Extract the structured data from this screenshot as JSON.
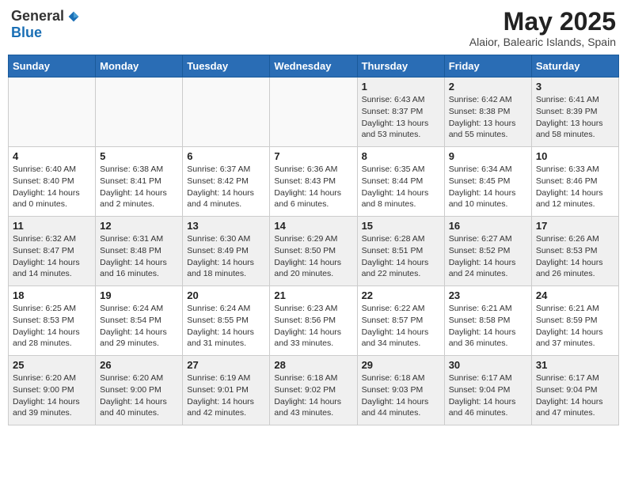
{
  "header": {
    "logo_general": "General",
    "logo_blue": "Blue",
    "month_year": "May 2025",
    "location": "Alaior, Balearic Islands, Spain"
  },
  "weekdays": [
    "Sunday",
    "Monday",
    "Tuesday",
    "Wednesday",
    "Thursday",
    "Friday",
    "Saturday"
  ],
  "rows": [
    [
      {
        "day": "",
        "empty": true
      },
      {
        "day": "",
        "empty": true
      },
      {
        "day": "",
        "empty": true
      },
      {
        "day": "",
        "empty": true
      },
      {
        "day": "1",
        "lines": [
          "Sunrise: 6:43 AM",
          "Sunset: 8:37 PM",
          "Daylight: 13 hours",
          "and 53 minutes."
        ]
      },
      {
        "day": "2",
        "lines": [
          "Sunrise: 6:42 AM",
          "Sunset: 8:38 PM",
          "Daylight: 13 hours",
          "and 55 minutes."
        ]
      },
      {
        "day": "3",
        "lines": [
          "Sunrise: 6:41 AM",
          "Sunset: 8:39 PM",
          "Daylight: 13 hours",
          "and 58 minutes."
        ]
      }
    ],
    [
      {
        "day": "4",
        "lines": [
          "Sunrise: 6:40 AM",
          "Sunset: 8:40 PM",
          "Daylight: 14 hours",
          "and 0 minutes."
        ]
      },
      {
        "day": "5",
        "lines": [
          "Sunrise: 6:38 AM",
          "Sunset: 8:41 PM",
          "Daylight: 14 hours",
          "and 2 minutes."
        ]
      },
      {
        "day": "6",
        "lines": [
          "Sunrise: 6:37 AM",
          "Sunset: 8:42 PM",
          "Daylight: 14 hours",
          "and 4 minutes."
        ]
      },
      {
        "day": "7",
        "lines": [
          "Sunrise: 6:36 AM",
          "Sunset: 8:43 PM",
          "Daylight: 14 hours",
          "and 6 minutes."
        ]
      },
      {
        "day": "8",
        "lines": [
          "Sunrise: 6:35 AM",
          "Sunset: 8:44 PM",
          "Daylight: 14 hours",
          "and 8 minutes."
        ]
      },
      {
        "day": "9",
        "lines": [
          "Sunrise: 6:34 AM",
          "Sunset: 8:45 PM",
          "Daylight: 14 hours",
          "and 10 minutes."
        ]
      },
      {
        "day": "10",
        "lines": [
          "Sunrise: 6:33 AM",
          "Sunset: 8:46 PM",
          "Daylight: 14 hours",
          "and 12 minutes."
        ]
      }
    ],
    [
      {
        "day": "11",
        "lines": [
          "Sunrise: 6:32 AM",
          "Sunset: 8:47 PM",
          "Daylight: 14 hours",
          "and 14 minutes."
        ]
      },
      {
        "day": "12",
        "lines": [
          "Sunrise: 6:31 AM",
          "Sunset: 8:48 PM",
          "Daylight: 14 hours",
          "and 16 minutes."
        ]
      },
      {
        "day": "13",
        "lines": [
          "Sunrise: 6:30 AM",
          "Sunset: 8:49 PM",
          "Daylight: 14 hours",
          "and 18 minutes."
        ]
      },
      {
        "day": "14",
        "lines": [
          "Sunrise: 6:29 AM",
          "Sunset: 8:50 PM",
          "Daylight: 14 hours",
          "and 20 minutes."
        ]
      },
      {
        "day": "15",
        "lines": [
          "Sunrise: 6:28 AM",
          "Sunset: 8:51 PM",
          "Daylight: 14 hours",
          "and 22 minutes."
        ]
      },
      {
        "day": "16",
        "lines": [
          "Sunrise: 6:27 AM",
          "Sunset: 8:52 PM",
          "Daylight: 14 hours",
          "and 24 minutes."
        ]
      },
      {
        "day": "17",
        "lines": [
          "Sunrise: 6:26 AM",
          "Sunset: 8:53 PM",
          "Daylight: 14 hours",
          "and 26 minutes."
        ]
      }
    ],
    [
      {
        "day": "18",
        "lines": [
          "Sunrise: 6:25 AM",
          "Sunset: 8:53 PM",
          "Daylight: 14 hours",
          "and 28 minutes."
        ]
      },
      {
        "day": "19",
        "lines": [
          "Sunrise: 6:24 AM",
          "Sunset: 8:54 PM",
          "Daylight: 14 hours",
          "and 29 minutes."
        ]
      },
      {
        "day": "20",
        "lines": [
          "Sunrise: 6:24 AM",
          "Sunset: 8:55 PM",
          "Daylight: 14 hours",
          "and 31 minutes."
        ]
      },
      {
        "day": "21",
        "lines": [
          "Sunrise: 6:23 AM",
          "Sunset: 8:56 PM",
          "Daylight: 14 hours",
          "and 33 minutes."
        ]
      },
      {
        "day": "22",
        "lines": [
          "Sunrise: 6:22 AM",
          "Sunset: 8:57 PM",
          "Daylight: 14 hours",
          "and 34 minutes."
        ]
      },
      {
        "day": "23",
        "lines": [
          "Sunrise: 6:21 AM",
          "Sunset: 8:58 PM",
          "Daylight: 14 hours",
          "and 36 minutes."
        ]
      },
      {
        "day": "24",
        "lines": [
          "Sunrise: 6:21 AM",
          "Sunset: 8:59 PM",
          "Daylight: 14 hours",
          "and 37 minutes."
        ]
      }
    ],
    [
      {
        "day": "25",
        "lines": [
          "Sunrise: 6:20 AM",
          "Sunset: 9:00 PM",
          "Daylight: 14 hours",
          "and 39 minutes."
        ]
      },
      {
        "day": "26",
        "lines": [
          "Sunrise: 6:20 AM",
          "Sunset: 9:00 PM",
          "Daylight: 14 hours",
          "and 40 minutes."
        ]
      },
      {
        "day": "27",
        "lines": [
          "Sunrise: 6:19 AM",
          "Sunset: 9:01 PM",
          "Daylight: 14 hours",
          "and 42 minutes."
        ]
      },
      {
        "day": "28",
        "lines": [
          "Sunrise: 6:18 AM",
          "Sunset: 9:02 PM",
          "Daylight: 14 hours",
          "and 43 minutes."
        ]
      },
      {
        "day": "29",
        "lines": [
          "Sunrise: 6:18 AM",
          "Sunset: 9:03 PM",
          "Daylight: 14 hours",
          "and 44 minutes."
        ]
      },
      {
        "day": "30",
        "lines": [
          "Sunrise: 6:17 AM",
          "Sunset: 9:04 PM",
          "Daylight: 14 hours",
          "and 46 minutes."
        ]
      },
      {
        "day": "31",
        "lines": [
          "Sunrise: 6:17 AM",
          "Sunset: 9:04 PM",
          "Daylight: 14 hours",
          "and 47 minutes."
        ]
      }
    ]
  ]
}
